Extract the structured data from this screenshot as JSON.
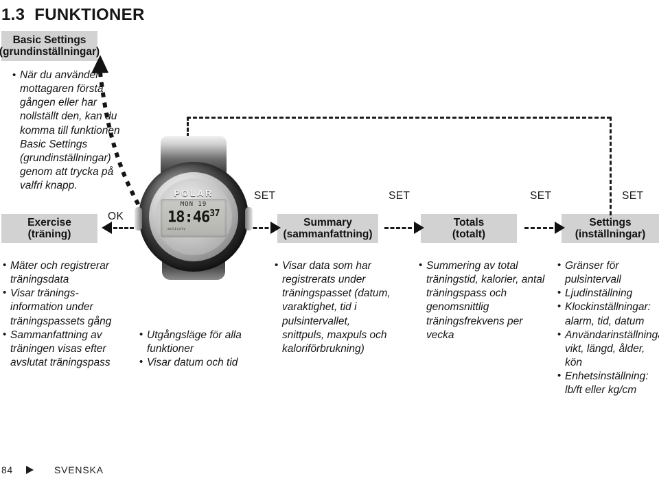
{
  "page": {
    "section_number": "1.3",
    "section_title": "FUNKTIONER",
    "footer_page_number": "84",
    "footer_language": "SVENSKA",
    "colors": {
      "box_gray": "#d2d2d2",
      "text_black": "#141414",
      "connector_black": "#1b1b1b"
    }
  },
  "boxes": {
    "basic_settings": {
      "en": "Basic Settings",
      "sv": "(grundinställningar)"
    },
    "exercise": {
      "en": "Exercise",
      "sv": "(träning)"
    },
    "summary": {
      "en": "Summary",
      "sv": "(sammanfattning)"
    },
    "totals": {
      "en": "Totals",
      "sv": "(totalt)"
    },
    "settings": {
      "en": "Settings",
      "sv": "(inställningar)"
    }
  },
  "controls": {
    "ok": "OK",
    "set_1": "SET",
    "set_2": "SET",
    "set_3": "SET",
    "set_4": "SET"
  },
  "watch": {
    "brand": "POLAR",
    "lcd_top": "MON 19",
    "lcd_time": "18:46",
    "lcd_seconds": "37",
    "lcd_footer": "activity"
  },
  "intro": {
    "bullets": [
      "När du använder mottagaren första gången eller har nollställt den, kan du komma till funktionen Basic Settings (grundinställningar) genom att trycka på valfri knapp."
    ]
  },
  "descriptions": {
    "exercise": [
      "Mäter och registrerar träningsdata",
      "Visar tränings-information under träningspassets gång",
      "Sammanfattning av träningen visas efter avslutat träningspass"
    ],
    "watch": [
      "Utgångsläge för alla funktioner",
      "Visar datum och tid"
    ],
    "summary": [
      "Visar data som har registrerats under träningspasset (datum, varaktighet, tid i pulsintervallet, snittpuls, maxpuls och kaloriförbrukning)"
    ],
    "totals": [
      "Summering av total träningstid, kalorier, antal träningspass och genomsnittlig träningsfrekvens per vecka"
    ],
    "settings": [
      "Gränser för pulsintervall",
      "Ljudinställning",
      "Klockinställningar: alarm, tid, datum",
      "Användarinställningar: vikt, längd, ålder, kön",
      "Enhetsinställning: lb/ft eller kg/cm"
    ]
  }
}
